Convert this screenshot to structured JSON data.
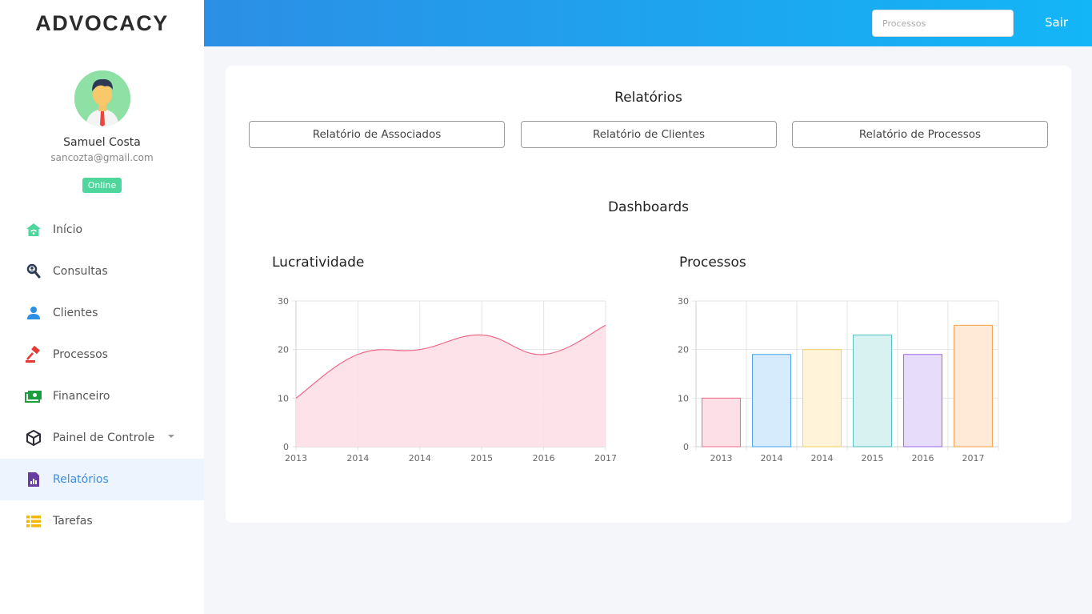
{
  "brand": "ADVOCACY",
  "user": {
    "name": "Samuel Costa",
    "email": "sancozta@gmail.com",
    "status": "Online"
  },
  "menu": [
    {
      "label": "Início",
      "icon": "home-icon",
      "color": "#4fd69c"
    },
    {
      "label": "Consultas",
      "icon": "user-search-icon",
      "color": "#2b3a55"
    },
    {
      "label": "Clientes",
      "icon": "user-icon",
      "color": "#2b8fe6"
    },
    {
      "label": "Processos",
      "icon": "gavel-icon",
      "color": "#e53935"
    },
    {
      "label": "Financeiro",
      "icon": "money-icon",
      "color": "#1b9e3e"
    },
    {
      "label": "Painel de Controle",
      "icon": "cube-icon",
      "color": "#2b2b3a"
    },
    {
      "label": "Relatórios",
      "icon": "report-icon",
      "color": "#6a3ea1"
    },
    {
      "label": "Tarefas",
      "icon": "list-icon",
      "color": "#f5b800"
    }
  ],
  "header": {
    "search_placeholder": "Processos",
    "logout_label": "Sair"
  },
  "reports": {
    "title": "Relatórios",
    "buttons": [
      "Relatório de Associados",
      "Relatório de Clientes",
      "Relatório de Processos"
    ]
  },
  "dashboards": {
    "title": "Dashboards"
  },
  "chart_data": [
    {
      "type": "area",
      "title": "Lucratividade",
      "categories": [
        "2013",
        "2014",
        "2014",
        "2015",
        "2016",
        "2017"
      ],
      "values": [
        10,
        19,
        20,
        23,
        19,
        25
      ],
      "ylim": [
        0,
        30
      ],
      "yticks": [
        0,
        10,
        20,
        30
      ],
      "grid": true,
      "colors": {
        "fill": "#fde0e7",
        "stroke": "#f06a8a"
      }
    },
    {
      "type": "bar",
      "title": "Processos",
      "categories": [
        "2013",
        "2014",
        "2014",
        "2015",
        "2016",
        "2017"
      ],
      "values": [
        10,
        19,
        20,
        23,
        19,
        25
      ],
      "ylim": [
        0,
        30
      ],
      "yticks": [
        0,
        10,
        20,
        30
      ],
      "grid": true,
      "colors": [
        {
          "fill": "#fde0e7",
          "stroke": "#f06a8a"
        },
        {
          "fill": "#d6ebfb",
          "stroke": "#4aa3e8"
        },
        {
          "fill": "#fff4d9",
          "stroke": "#f5cf5c"
        },
        {
          "fill": "#d8f1f1",
          "stroke": "#4fc0c0"
        },
        {
          "fill": "#e8dcfb",
          "stroke": "#9b6bea"
        },
        {
          "fill": "#feead6",
          "stroke": "#f5a04a"
        }
      ]
    }
  ]
}
